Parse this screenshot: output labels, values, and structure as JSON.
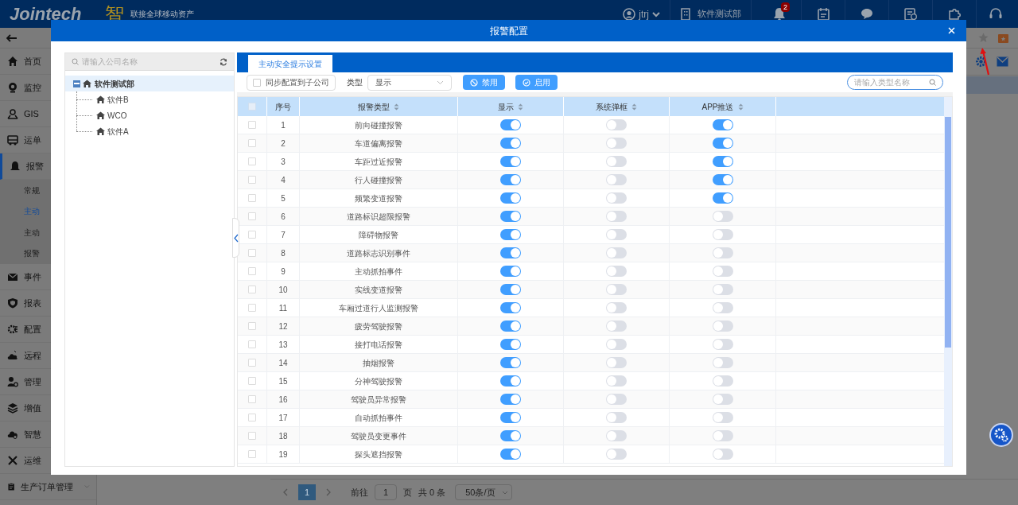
{
  "header": {
    "logo": "Jointech",
    "logo_mark": "智",
    "slogan": "联接全球移动资产",
    "user": "jtrj",
    "company": "软件测试部",
    "notification_count": "2"
  },
  "sidebar": {
    "items": [
      {
        "label": "首页",
        "selected": false
      },
      {
        "label": "监控",
        "selected": false
      },
      {
        "label": "GIS",
        "selected": false
      },
      {
        "label": "运单",
        "selected": false
      },
      {
        "label": "报警",
        "selected": true,
        "expanded": true,
        "children": [
          {
            "label": "常规",
            "selected": false
          },
          {
            "label": "主动",
            "selected": true
          },
          {
            "label": "主动",
            "selected": false
          },
          {
            "label": "报警",
            "selected": false
          }
        ]
      },
      {
        "label": "事件",
        "selected": false
      },
      {
        "label": "报表",
        "selected": false
      },
      {
        "label": "配置",
        "selected": false
      },
      {
        "label": "远程",
        "selected": false
      },
      {
        "label": "管理",
        "selected": false
      },
      {
        "label": "增值",
        "selected": false
      },
      {
        "label": "智慧",
        "selected": false
      },
      {
        "label": "运维",
        "selected": false
      },
      {
        "label": "生产订单管理",
        "selected": false,
        "expanded": false
      }
    ]
  },
  "pagination": {
    "page": "1",
    "goto_label": "前往",
    "goto_value": "1",
    "page_unit": "页",
    "total": "共 0 条",
    "page_size": "50条/页"
  },
  "dialog": {
    "title": "报警配置",
    "company_search": {
      "placeholder": "请输入公司名称"
    },
    "tree": [
      {
        "label": "软件测试部",
        "selected": true,
        "expanded": true,
        "children": [
          {
            "label": "软件B",
            "selected": false
          },
          {
            "label": "WCO",
            "selected": false
          },
          {
            "label": "软件A",
            "selected": false
          }
        ]
      }
    ],
    "tabs": [
      {
        "label": "主动安全提示设置",
        "selected": true
      }
    ],
    "sync_checkbox": {
      "label": "同步配置到子公司",
      "checked": false
    },
    "type_filter": {
      "label": "类型",
      "value": "显示"
    },
    "buttons": [
      {
        "label": "禁用",
        "kind": "disable"
      },
      {
        "label": "启用",
        "kind": "enable"
      }
    ],
    "type_search": {
      "placeholder": "请输入类型名称"
    },
    "table": {
      "all_checked": false,
      "columns": [
        "序号",
        "报警类型",
        "显示",
        "系统弹框",
        "APP推送"
      ],
      "rows": [
        {
          "index": "1",
          "type": "前向碰撞报警",
          "display": true,
          "popup": false,
          "app_push": true,
          "checked": false
        },
        {
          "index": "2",
          "type": "车道偏离报警",
          "display": true,
          "popup": false,
          "app_push": true,
          "checked": false
        },
        {
          "index": "3",
          "type": "车距过近报警",
          "display": true,
          "popup": false,
          "app_push": true,
          "checked": false
        },
        {
          "index": "4",
          "type": "行人碰撞报警",
          "display": true,
          "popup": false,
          "app_push": true,
          "checked": false
        },
        {
          "index": "5",
          "type": "频繁变道报警",
          "display": true,
          "popup": false,
          "app_push": true,
          "checked": false
        },
        {
          "index": "6",
          "type": "道路标识超限报警",
          "display": true,
          "popup": false,
          "app_push": false,
          "checked": false
        },
        {
          "index": "7",
          "type": "障碍物报警",
          "display": true,
          "popup": false,
          "app_push": false,
          "checked": false
        },
        {
          "index": "8",
          "type": "道路标志识别事件",
          "display": true,
          "popup": false,
          "app_push": false,
          "checked": false
        },
        {
          "index": "9",
          "type": "主动抓拍事件",
          "display": true,
          "popup": false,
          "app_push": false,
          "checked": false
        },
        {
          "index": "10",
          "type": "实线变道报警",
          "display": true,
          "popup": false,
          "app_push": false,
          "checked": false
        },
        {
          "index": "11",
          "type": "车厢过道行人监测报警",
          "display": true,
          "popup": false,
          "app_push": false,
          "checked": false
        },
        {
          "index": "12",
          "type": "疲劳驾驶报警",
          "display": true,
          "popup": false,
          "app_push": false,
          "checked": false
        },
        {
          "index": "13",
          "type": "接打电话报警",
          "display": true,
          "popup": false,
          "app_push": false,
          "checked": false
        },
        {
          "index": "14",
          "type": "抽烟报警",
          "display": true,
          "popup": false,
          "app_push": false,
          "checked": false
        },
        {
          "index": "15",
          "type": "分神驾驶报警",
          "display": true,
          "popup": false,
          "app_push": false,
          "checked": false
        },
        {
          "index": "16",
          "type": "驾驶员异常报警",
          "display": true,
          "popup": false,
          "app_push": false,
          "checked": false
        },
        {
          "index": "17",
          "type": "自动抓拍事件",
          "display": true,
          "popup": false,
          "app_push": false,
          "checked": false
        },
        {
          "index": "18",
          "type": "驾驶员变更事件",
          "display": true,
          "popup": false,
          "app_push": false,
          "checked": false
        },
        {
          "index": "19",
          "type": "探头遮挡报警",
          "display": true,
          "popup": false,
          "app_push": false,
          "checked": false
        }
      ]
    }
  }
}
